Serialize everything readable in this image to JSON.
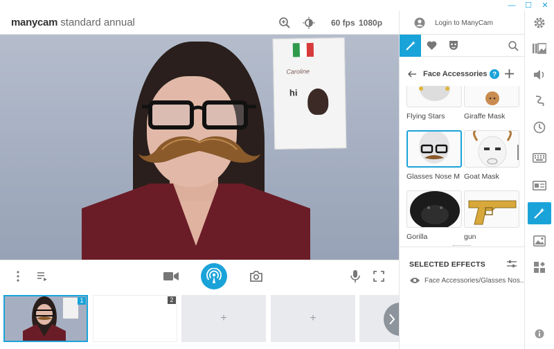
{
  "window": {
    "minimize": "—",
    "maximize": "☐",
    "close": "✕"
  },
  "header": {
    "brand_bold": "manycam",
    "brand_light": "standard annual",
    "fps": "60 fps",
    "resolution": "1080p",
    "login": "Login to ManyCam"
  },
  "video": {
    "poster_text": "Caroline",
    "poster_hi": "hi"
  },
  "effects": {
    "category": "Face Accessories",
    "items": [
      {
        "label": "Flying Stars"
      },
      {
        "label": "Giraffe Mask"
      },
      {
        "label": "Glasses Nose M"
      },
      {
        "label": "Goat Mask"
      },
      {
        "label": "Gorilla"
      },
      {
        "label": "gun"
      }
    ],
    "selected_header": "SELECTED EFFECTS",
    "selected_items": [
      "Face Accessories/Glasses Nos..."
    ]
  },
  "thumbnails": [
    {
      "badge": "1",
      "state": "active"
    },
    {
      "badge": "2",
      "state": "blank"
    },
    {
      "plus": "+",
      "state": "empty"
    },
    {
      "plus": "+",
      "state": "empty"
    }
  ],
  "colors": {
    "accent": "#1aa3d9",
    "shirt": "#6b1d27"
  }
}
